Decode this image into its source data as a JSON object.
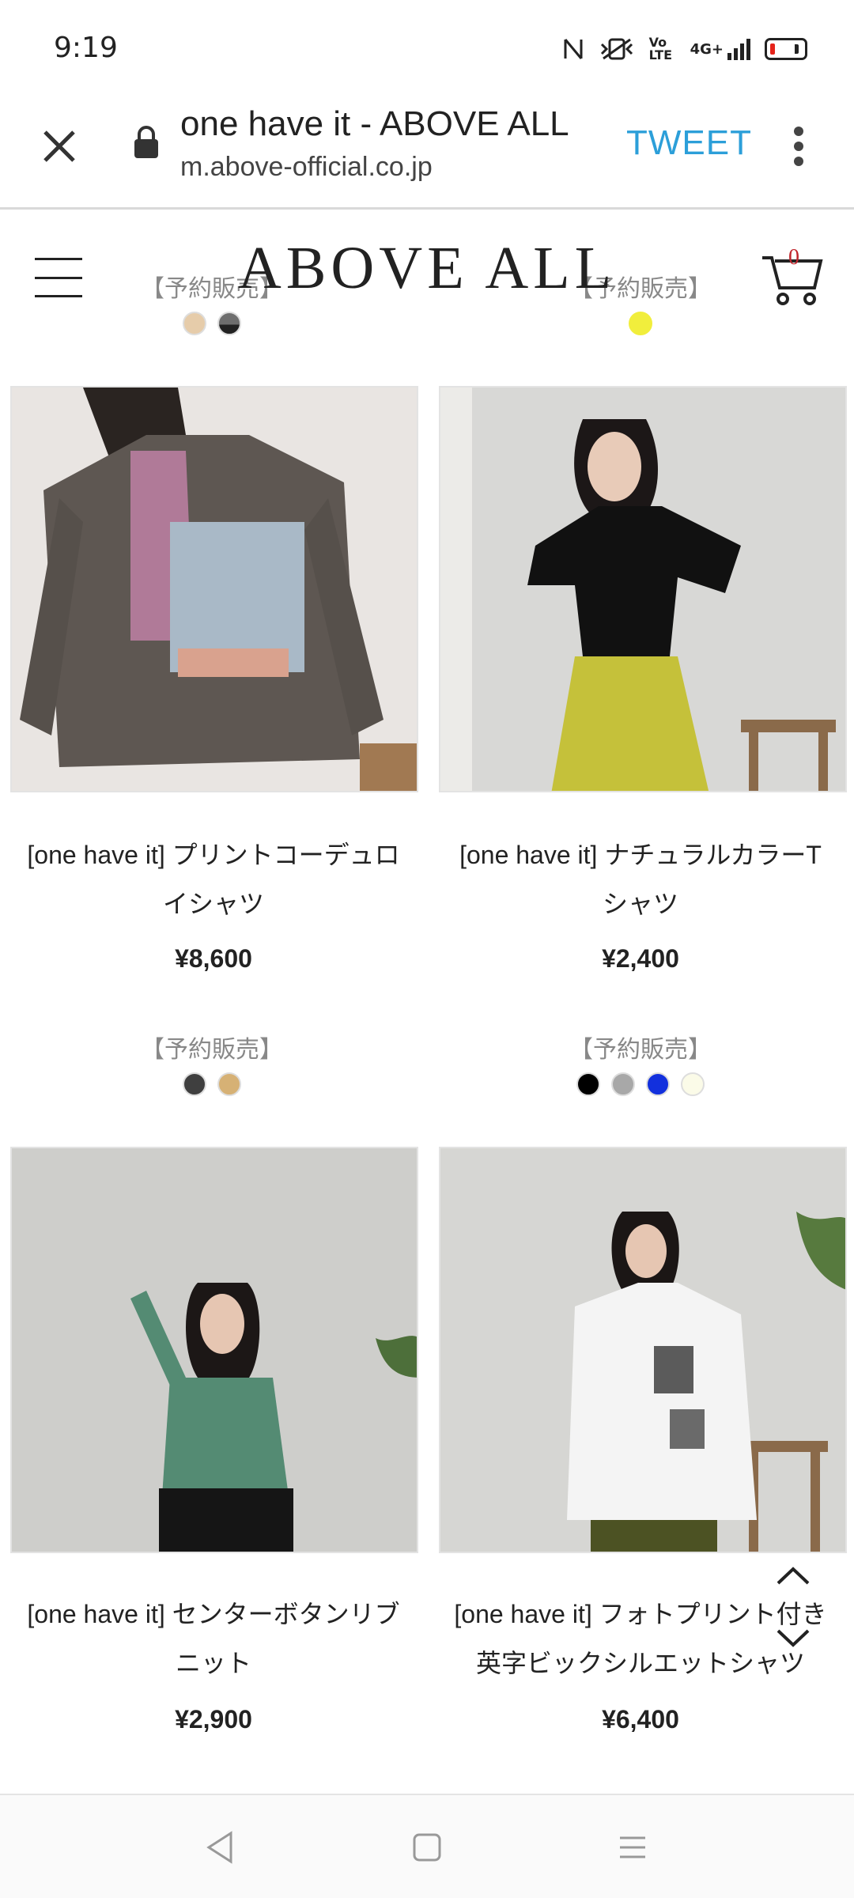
{
  "status_bar": {
    "time": "9:19",
    "icons": [
      "nfc-icon",
      "vibrate-icon",
      "volte-icon",
      "signal-4g-icon",
      "battery-low-icon"
    ],
    "volte_text": "Vo LTE",
    "network_text": "4G+"
  },
  "toolbar": {
    "title": "one have it - ABOVE ALL",
    "url": "m.above-official.co.jp",
    "tweet_label": "TWEET"
  },
  "site_header": {
    "logo": "ABOVE ALL",
    "cart_count": "0"
  },
  "top_row": {
    "left": {
      "preorder_label": "【予約販売】",
      "swatches": [
        "#e6ccaa",
        "#6e6e6e"
      ]
    },
    "right": {
      "preorder_label": "【予約販売】",
      "swatches": [
        "#f1ee3c"
      ]
    }
  },
  "products": [
    {
      "name_line1": "[one have it] プリントコーデュロ",
      "name_line2": "イシャツ",
      "price": "¥8,600",
      "preorder_label": "【予約販売】",
      "swatches": [
        "#3f3f3f",
        "#d6b175"
      ]
    },
    {
      "name_line1": "[one have it] ナチュラルカラーT",
      "name_line2": "シャツ",
      "price": "¥2,400",
      "preorder_label": "【予約販売】",
      "swatches": [
        "#000000",
        "#a8a8a8",
        "#1230dd",
        "#fbfbe8"
      ]
    },
    {
      "name_line1": "[one have it] センターボタンリブ",
      "name_line2": "ニット",
      "price": "¥2,900"
    },
    {
      "name_line1": "[one have it] フォトプリント付き",
      "name_line2": "英字ビックシルエットシャツ",
      "price": "¥6,400"
    }
  ],
  "colors": {
    "tweet": "#2c9fd9",
    "cart_count": "#c0252c",
    "battery_low": "#e5231a"
  }
}
